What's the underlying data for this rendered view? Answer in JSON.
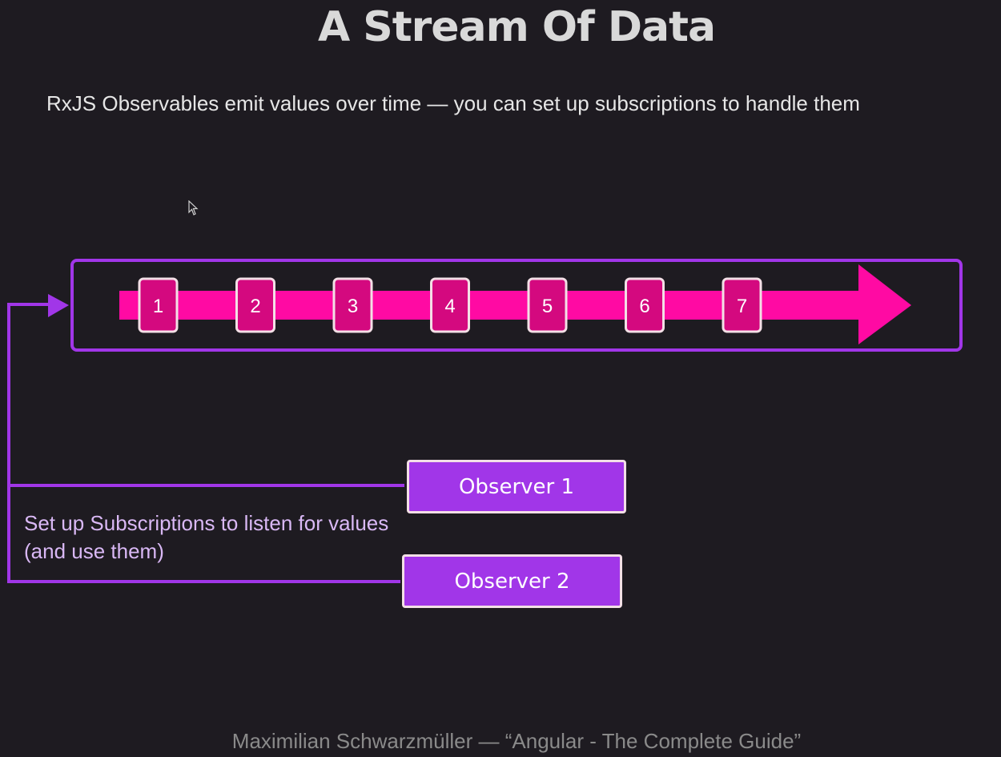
{
  "title": "A Stream Of Data",
  "subtitle": "RxJS Observables emit values over time — you can set up subscriptions to handle them",
  "stream": {
    "values": [
      "1",
      "2",
      "3",
      "4",
      "5",
      "6",
      "7"
    ]
  },
  "observers": [
    {
      "label": "Observer 1"
    },
    {
      "label": "Observer 2"
    }
  ],
  "note": "Set up Subscriptions to listen for values (and use them)",
  "footer": "Maximilian Schwarzmüller — “Angular - The Complete Guide”",
  "colors": {
    "background": "#1e1b21",
    "stream_arrow": "#ff0aa3",
    "token_fill": "#d4097f",
    "token_border": "#f3dfe6",
    "frame": "#a136e8",
    "observer_fill": "#a136e8"
  }
}
